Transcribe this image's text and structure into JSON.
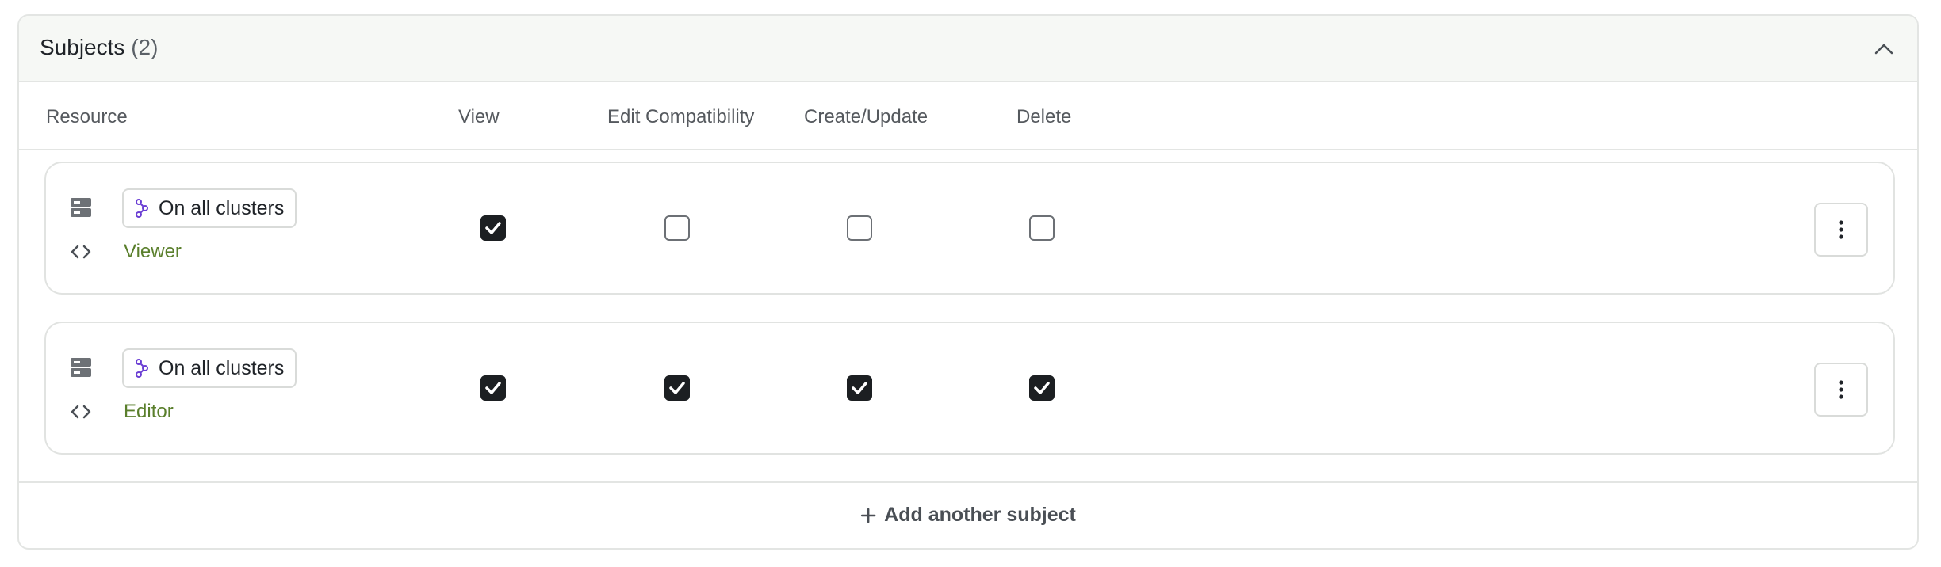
{
  "panel": {
    "title": "Subjects",
    "count": "(2)"
  },
  "columns": {
    "resource": "Resource",
    "view": "View",
    "edit_compatibility": "Edit Compatibility",
    "create_update": "Create/Update",
    "delete": "Delete"
  },
  "rows": [
    {
      "scope": "On all clusters",
      "role": "Viewer",
      "permissions": {
        "view": true,
        "edit_compatibility": false,
        "create_update": false,
        "delete": false
      }
    },
    {
      "scope": "On all clusters",
      "role": "Editor",
      "permissions": {
        "view": true,
        "edit_compatibility": true,
        "create_update": true,
        "delete": true
      }
    }
  ],
  "footer": {
    "add_label": "Add another subject"
  },
  "colors": {
    "role_link": "#5a7f2c",
    "cluster_icon": "#6b3fd4",
    "checkbox_checked": "#1c1f22"
  },
  "icons": [
    "chevron-up-icon",
    "server-icon",
    "code-icon",
    "cluster-icon",
    "check-icon",
    "more-vertical-icon",
    "plus-icon"
  ]
}
